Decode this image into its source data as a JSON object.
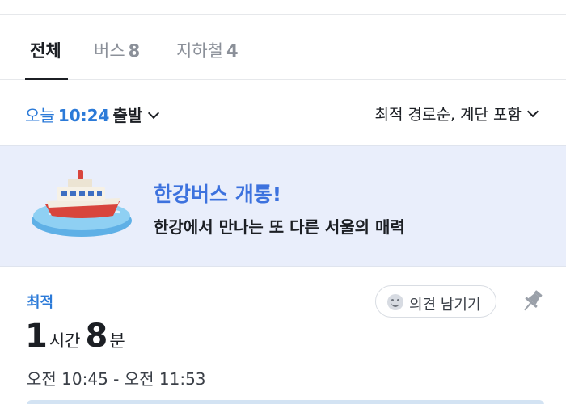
{
  "tabs": [
    {
      "label": "전체",
      "count": ""
    },
    {
      "label": "버스",
      "count": "8"
    },
    {
      "label": "지하철",
      "count": "4"
    }
  ],
  "options": {
    "today": "오늘",
    "time": "10:24",
    "depart_suffix": "출발",
    "sort": "최적 경로순, 계단 포함"
  },
  "banner": {
    "title": "한강버스 개통!",
    "subtitle": "한강에서 만나는 또 다른 서울의 매력",
    "art_icon": "ferry-boat-icon"
  },
  "result": {
    "tag": "최적",
    "feedback_label": "의견 남기기",
    "feedback_icon": "smile-icon",
    "pin_icon": "pin-icon",
    "hours": "1",
    "hours_unit": "시간",
    "minutes": "8",
    "minutes_unit": "분",
    "time_range": "오전 10:45 - 오전 11:53"
  },
  "colors": {
    "accent": "#2b7ad8",
    "banner_bg": "#e9eefb",
    "banner_title": "#3d72de"
  }
}
